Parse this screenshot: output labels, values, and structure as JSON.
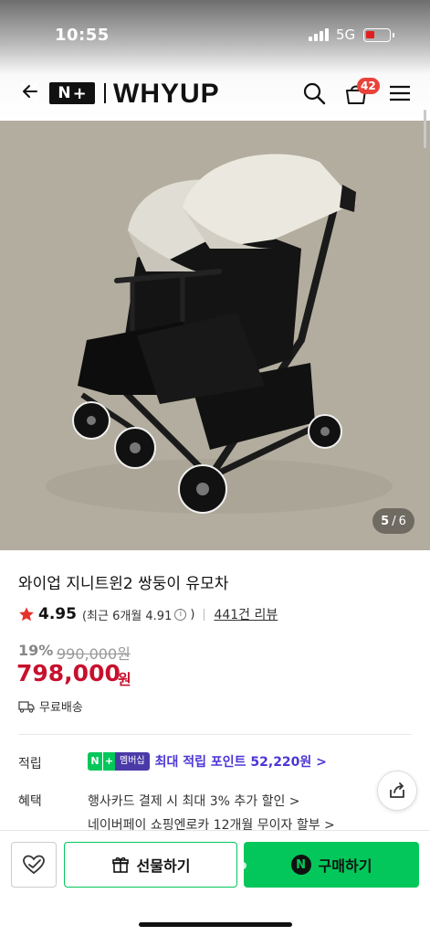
{
  "status": {
    "time": "10:55",
    "network": "5G"
  },
  "header": {
    "brand": "WHYUP",
    "logo_text": "N",
    "cart_count": "42"
  },
  "image": {
    "current": "5",
    "separator": "/",
    "total": "6"
  },
  "product": {
    "title": "와이업 지니트윈2 쌍둥이 유모차",
    "rating": "4.95",
    "recent_rating": "(최근 6개월 4.91",
    "recent_close": ")",
    "info_icon": "i",
    "reviews": "441건 리뷰",
    "discount": "19%",
    "original_price": "990,000원",
    "price": "798,000",
    "currency": "원",
    "shipping": "무료배송"
  },
  "points": {
    "label": "적립",
    "badge_n": "N",
    "badge_plus": "+",
    "badge_member": "멤버십",
    "text": "최대 적립 포인트 52,220원 >"
  },
  "benefits": {
    "label": "혜택",
    "items": [
      "행사카드 결제 시 최대 3% 추가 할인 >",
      "네이버페이 쇼핑엔로카 12개월 무이자 할부 >"
    ]
  },
  "actions": {
    "gift": "선물하기",
    "buy": "구매하기",
    "npay_glyph": "N"
  },
  "colors": {
    "green": "#03c75a",
    "red": "#c8102e",
    "purple": "#4b36d6",
    "badge": "#e8423a"
  }
}
